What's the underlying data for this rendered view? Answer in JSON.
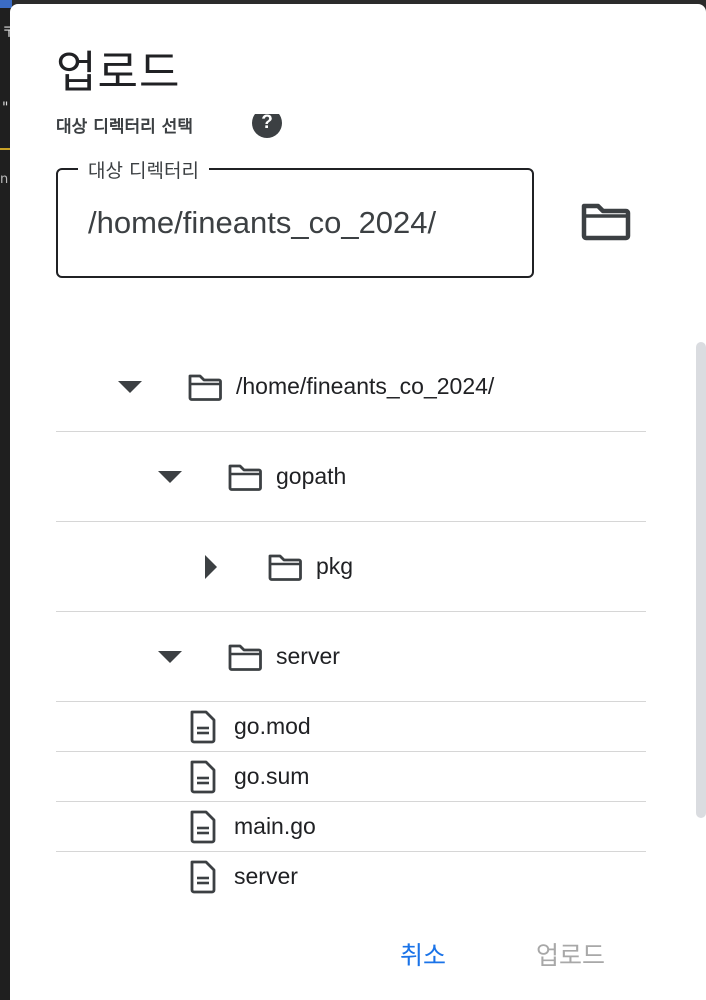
{
  "background": {
    "glyph_top": "〒",
    "glyph_mid": "\"",
    "glyph_low": "n"
  },
  "dialog": {
    "title": "업로드",
    "section_label": "대상 디렉터리 선택",
    "help_icon": "?",
    "directory_field": {
      "label": "대상 디렉터리",
      "value": "/home/fineants_co_2024/"
    },
    "browse_icon": "folder-icon"
  },
  "tree": {
    "nodes": [
      {
        "type": "folder",
        "label": "/home/fineants_co_2024/",
        "expanded": true,
        "depth": 0
      },
      {
        "type": "folder",
        "label": "gopath",
        "expanded": true,
        "depth": 1
      },
      {
        "type": "folder",
        "label": "pkg",
        "expanded": false,
        "depth": 2
      },
      {
        "type": "folder",
        "label": "server",
        "expanded": true,
        "depth": 1
      },
      {
        "type": "file",
        "label": "go.mod"
      },
      {
        "type": "file",
        "label": "go.sum"
      },
      {
        "type": "file",
        "label": "main.go"
      },
      {
        "type": "file",
        "label": "server"
      }
    ]
  },
  "actions": {
    "cancel": "취소",
    "upload": "업로드"
  },
  "colors": {
    "primary": "#1a73e8",
    "disabled": "#a8a8a8",
    "text": "#202124",
    "icon": "#3c4043"
  }
}
